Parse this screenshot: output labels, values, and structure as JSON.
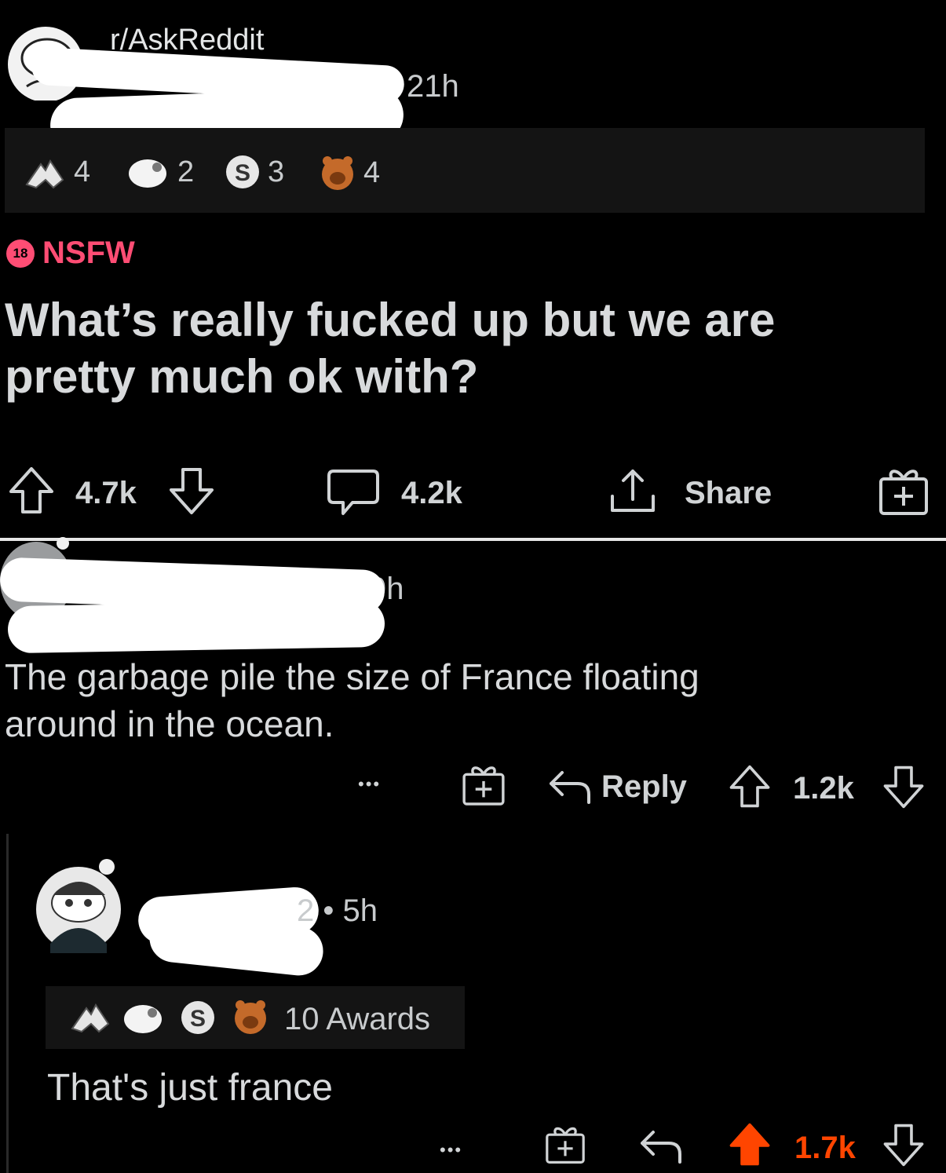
{
  "post": {
    "subreddit": "r/AskReddit",
    "time": "21h",
    "awards": [
      {
        "icon": "wholesome-hug-icon",
        "count": "4"
      },
      {
        "icon": "helpful-icon",
        "count": "2"
      },
      {
        "icon": "silver-icon",
        "count": "3"
      },
      {
        "icon": "facepalm-bear-icon",
        "count": "4"
      }
    ],
    "nsfw_badge": "18",
    "nsfw_label": "NSFW",
    "title_line1": "What’s really fucked up but we are",
    "title_line2": "pretty much ok with?",
    "upvotes": "4.7k",
    "comments": "4.2k",
    "share_label": "Share"
  },
  "comment1": {
    "time": "9h",
    "body_line1": "The garbage pile the size of France floating",
    "body_line2": "around in the ocean.",
    "more": "•••",
    "reply_label": "Reply",
    "score": "1.2k"
  },
  "comment2": {
    "meta_suffix": "2 • 5h",
    "awards_label": "10 Awards",
    "body": "That's just france",
    "more": "•••",
    "score": "1.7k",
    "upvote_color": "#ff4500"
  },
  "colors": {
    "nsfw": "#ff4d74",
    "upvoted": "#ff4500",
    "background": "#000000"
  }
}
